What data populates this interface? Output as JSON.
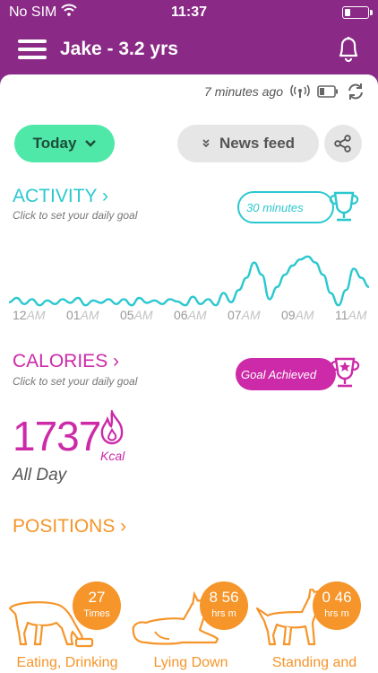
{
  "status_bar": {
    "carrier": "No SIM",
    "time": "11:37"
  },
  "app_bar": {
    "title": "Jake - 3.2 yrs"
  },
  "sync": {
    "last_synced": "7 minutes ago"
  },
  "filters": {
    "period_label": "Today",
    "newsfeed_label": "News feed"
  },
  "activity": {
    "title": "ACTIVITY ›",
    "subtitle": "Click to set your daily goal",
    "goal_label": "30 minutes",
    "color": "#2bc8cf"
  },
  "chart_data": {
    "type": "line",
    "x_tick_labels": [
      {
        "num": "12",
        "ampm": "AM"
      },
      {
        "num": "01",
        "ampm": "AM"
      },
      {
        "num": "05",
        "ampm": "AM"
      },
      {
        "num": "06",
        "ampm": "AM"
      },
      {
        "num": "07",
        "ampm": "AM"
      },
      {
        "num": "09",
        "ampm": "AM"
      },
      {
        "num": "11",
        "ampm": "AM"
      }
    ],
    "values": [
      0.15,
      0.22,
      0.12,
      0.2,
      0.1,
      0.18,
      0.12,
      0.2,
      0.14,
      0.22,
      0.1,
      0.18,
      0.14,
      0.2,
      0.12,
      0.2,
      0.1,
      0.22,
      0.14,
      0.18,
      0.12,
      0.2,
      0.16,
      0.1,
      0.24,
      0.12,
      0.2,
      0.1,
      0.3,
      0.15,
      0.35,
      0.55,
      0.8,
      0.6,
      0.2,
      0.4,
      0.6,
      0.75,
      0.85,
      0.9,
      0.8,
      0.6,
      0.3,
      0.1,
      0.35,
      0.7,
      0.55,
      0.4
    ],
    "ylim": [
      0,
      1
    ],
    "grid": false,
    "color": "#2bc8cf"
  },
  "calories": {
    "title": "CALORIES ›",
    "subtitle": "Click to set your daily goal",
    "goal_label": "Goal Achieved",
    "value": "1737",
    "unit": "Kcal",
    "period": "All Day",
    "color": "#cc2aa8"
  },
  "positions": {
    "title": "POSITIONS ›",
    "color": "#f5952a",
    "items": [
      {
        "value": "27",
        "unit": "Times",
        "label": "Eating, Drinking",
        "icon": "dog-eating-icon"
      },
      {
        "value": "8 56",
        "unit": "hrs m",
        "label": "Lying Down",
        "icon": "dog-lying-icon"
      },
      {
        "value": "0 46",
        "unit": "hrs m",
        "label": "Standing and",
        "icon": "dog-standing-icon"
      }
    ]
  }
}
